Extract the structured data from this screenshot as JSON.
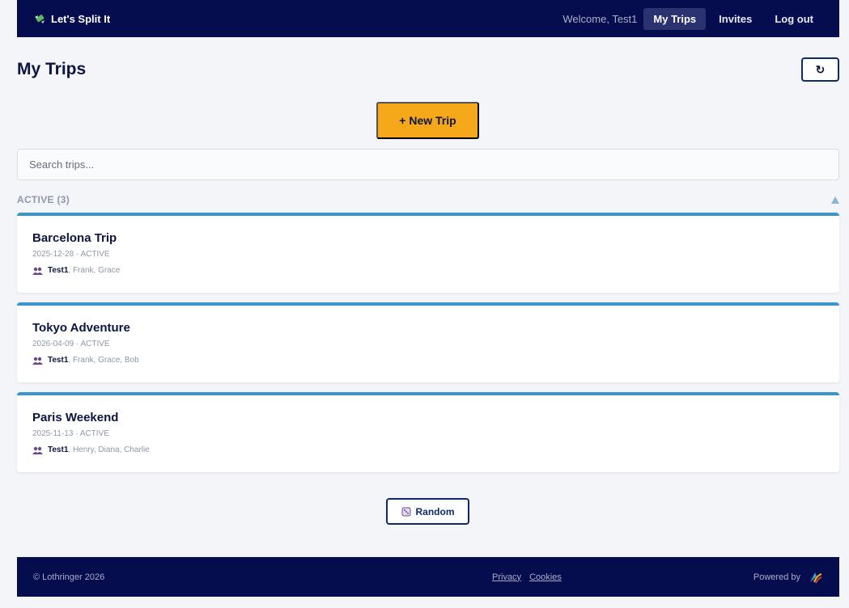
{
  "header": {
    "brand": "Let's Split It",
    "welcome": "Welcome, Test1",
    "nav": [
      "My Trips",
      "Invites",
      "Log out"
    ]
  },
  "page": {
    "title": "My Trips",
    "refresh_label": "↻",
    "new_trip_label": "+ New Trip",
    "search_placeholder": "Search trips..."
  },
  "section": {
    "label": "ACTIVE (3)"
  },
  "trips": [
    {
      "name": "Barcelona Trip",
      "meta": "2025-12-28 · ACTIVE",
      "owner": "Test1",
      "others": ", Frank, Grace"
    },
    {
      "name": "Tokyo Adventure",
      "meta": "2026-04-09 · ACTIVE",
      "owner": "Test1",
      "others": ", Frank, Grace, Bob"
    },
    {
      "name": "Paris Weekend",
      "meta": "2025-11-13 · ACTIVE",
      "owner": "Test1",
      "others": ", Henry, Diana, Charlie"
    }
  ],
  "random_label": "Random",
  "footer": {
    "copyright": "© Lothringer 2026",
    "privacy": "Privacy",
    "cookies": "Cookies",
    "powered_by": "Powered by"
  },
  "colors": {
    "nav_bg": "#060d4f",
    "accent": "#f6a81b",
    "card_border": "#3a96c8"
  }
}
